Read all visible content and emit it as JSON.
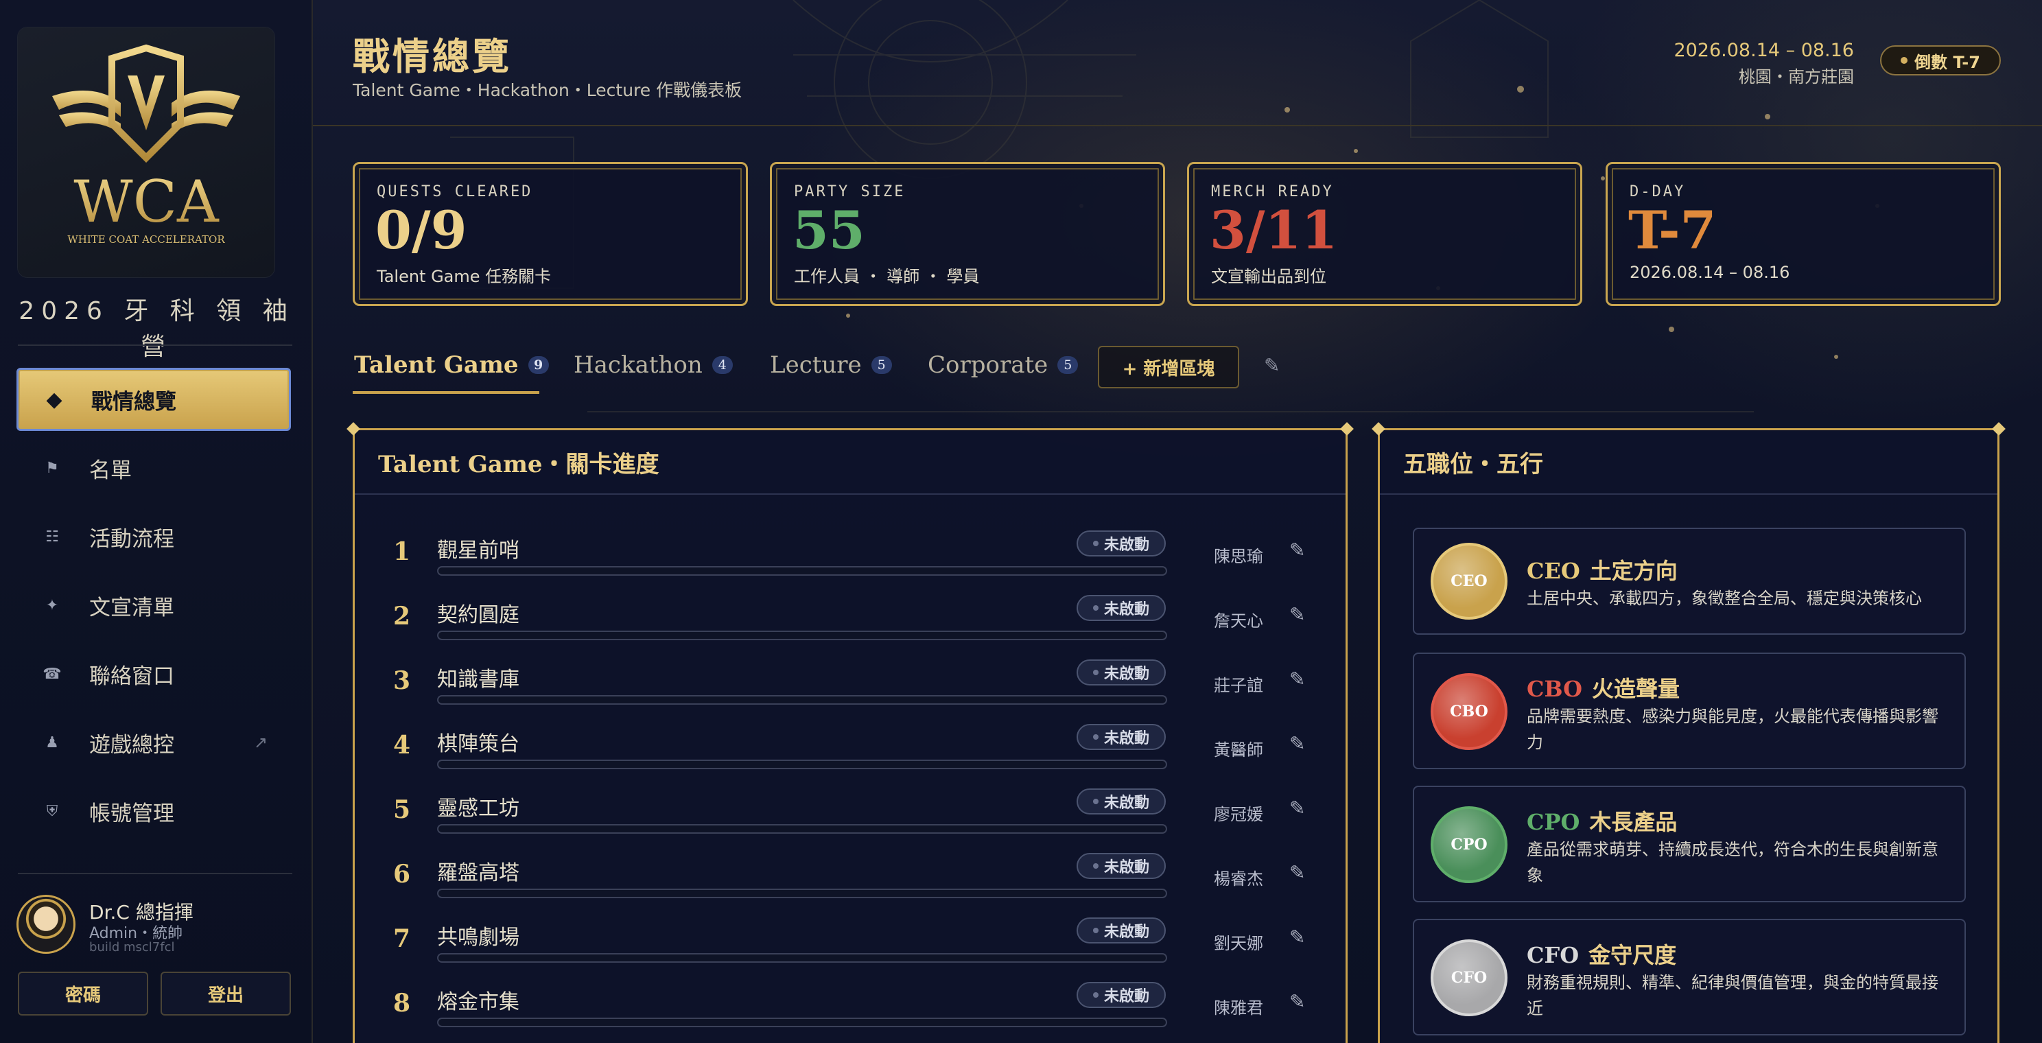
{
  "sidebar": {
    "logo_text": "WCA",
    "logo_subtext": "WHITE COAT ACCELERATOR",
    "camp_name": "2026 牙 科 領 袖 營",
    "nav": [
      {
        "label": "戰情總覽",
        "icon": "diamond-icon",
        "active": true
      },
      {
        "label": "名單",
        "icon": "flag-icon"
      },
      {
        "label": "活動流程",
        "icon": "list-icon"
      },
      {
        "label": "文宣清單",
        "icon": "sparkle-icon"
      },
      {
        "label": "聯絡窗口",
        "icon": "phone-icon"
      },
      {
        "label": "遊戲總控",
        "icon": "pawn-icon",
        "external": "↗"
      },
      {
        "label": "帳號管理",
        "icon": "shield-icon"
      }
    ],
    "user": {
      "name": "Dr.C 總指揮",
      "role": "Admin・統帥",
      "build": "build mscl7fcl"
    },
    "password_button": "密碼",
    "logout_button": "登出"
  },
  "header": {
    "title": "戰情總覽",
    "subtitle": "Talent Game・Hackathon・Lecture 作戰儀表板",
    "date_range": "2026.08.14 – 08.16",
    "location": "桃園・南方莊園",
    "countdown": "倒數 T-7"
  },
  "stats": [
    {
      "label": "QUESTS CLEARED",
      "value": "0/9",
      "desc": "Talent Game 任務關卡",
      "color": "#ecd08a"
    },
    {
      "label": "PARTY SIZE",
      "value": "55",
      "desc": "工作人員 ・ 導師 ・ 學員",
      "color": "#5fae6a"
    },
    {
      "label": "MERCH READY",
      "value": "3/11",
      "desc": "文宣輸出品到位",
      "color": "#d2503e"
    },
    {
      "label": "D-DAY",
      "value": "T-7",
      "desc": "2026.08.14 – 08.16",
      "color": "#e08a3c"
    }
  ],
  "tabs": [
    {
      "label": "Talent Game",
      "count": "9",
      "active": true
    },
    {
      "label": "Hackathon",
      "count": "4"
    },
    {
      "label": "Lecture",
      "count": "5"
    },
    {
      "label": "Corporate",
      "count": "5"
    }
  ],
  "add_zone_button": "+ 新增區塊",
  "quest_panel": {
    "title": "Talent Game・關卡進度",
    "quests": [
      {
        "num": "1",
        "name": "觀星前哨",
        "status": "未啟動",
        "owner": "陳思瑜",
        "progress": 0
      },
      {
        "num": "2",
        "name": "契約圓庭",
        "status": "未啟動",
        "owner": "詹天心",
        "progress": 0
      },
      {
        "num": "3",
        "name": "知識書庫",
        "status": "未啟動",
        "owner": "莊子誼",
        "progress": 0
      },
      {
        "num": "4",
        "name": "棋陣策台",
        "status": "未啟動",
        "owner": "黃醫師",
        "progress": 0
      },
      {
        "num": "5",
        "name": "靈感工坊",
        "status": "未啟動",
        "owner": "廖冠媛",
        "progress": 0
      },
      {
        "num": "6",
        "name": "羅盤高塔",
        "status": "未啟動",
        "owner": "楊睿杰",
        "progress": 0
      },
      {
        "num": "7",
        "name": "共鳴劇場",
        "status": "未啟動",
        "owner": "劉天娜",
        "progress": 0
      },
      {
        "num": "8",
        "name": "熔金市集",
        "status": "未啟動",
        "owner": "陳雅君",
        "progress": 0
      }
    ]
  },
  "roles_panel": {
    "title": "五職位・五行",
    "roles": [
      {
        "code": "CEO",
        "cn": "土定方向",
        "desc": "土居中央、承載四方，象徵整合全局、穩定與決策核心",
        "color": "#e6c97a",
        "coin": "#c9a24c"
      },
      {
        "code": "CBO",
        "cn": "火造聲量",
        "desc": "品牌需要熱度、感染力與能見度，火最能代表傳播與影響力",
        "color": "#e0584a",
        "coin": "#c9402f"
      },
      {
        "code": "CPO",
        "cn": "木長產品",
        "desc": "產品從需求萌芽、持續成長迭代，符合木的生長與創新意象",
        "color": "#5fae6a",
        "coin": "#4a8f5a"
      },
      {
        "code": "CFO",
        "cn": "金守尺度",
        "desc": "財務重視規則、精準、紀律與價值管理，與金的特質最接近",
        "color": "#d8d8d8",
        "coin": "#a8a8aa"
      }
    ]
  }
}
